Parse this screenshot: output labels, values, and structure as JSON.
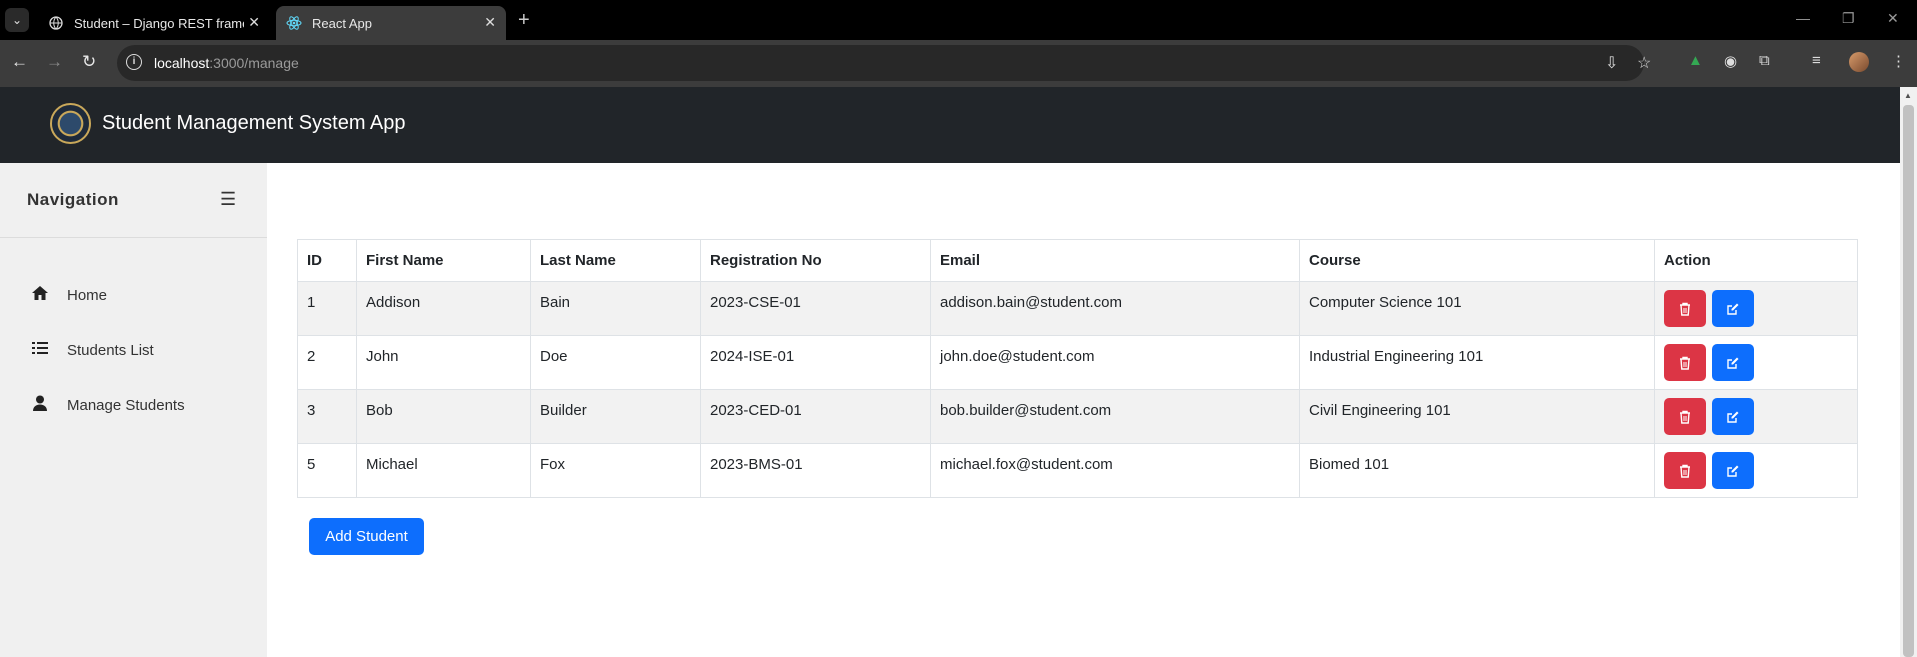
{
  "browser": {
    "tabs": [
      {
        "title": "Student – Django REST framew",
        "icon": "globe-icon",
        "active": false
      },
      {
        "title": "React App",
        "icon": "react-icon",
        "active": true
      }
    ],
    "url_host": "localhost",
    "url_path": ":3000/manage"
  },
  "app": {
    "title": "Student Management System App"
  },
  "sidebar": {
    "heading": "Navigation",
    "items": [
      {
        "label": "Home",
        "icon": "home-icon"
      },
      {
        "label": "Students List",
        "icon": "list-icon"
      },
      {
        "label": "Manage Students",
        "icon": "user-icon"
      }
    ]
  },
  "table": {
    "headers": [
      "ID",
      "First Name",
      "Last Name",
      "Registration No",
      "Email",
      "Course",
      "Action"
    ],
    "rows": [
      {
        "id": "1",
        "first": "Addison",
        "last": "Bain",
        "reg": "2023-CSE-01",
        "email": "addison.bain@student.com",
        "course": "Computer Science 101"
      },
      {
        "id": "2",
        "first": "John",
        "last": "Doe",
        "reg": "2024-ISE-01",
        "email": "john.doe@student.com",
        "course": "Industrial Engineering 101"
      },
      {
        "id": "3",
        "first": "Bob",
        "last": "Builder",
        "reg": "2023-CED-01",
        "email": "bob.builder@student.com",
        "course": "Civil Engineering 101"
      },
      {
        "id": "5",
        "first": "Michael",
        "last": "Fox",
        "reg": "2023-BMS-01",
        "email": "michael.fox@student.com",
        "course": "Biomed 101"
      }
    ]
  },
  "actions": {
    "add_student": "Add Student"
  },
  "colors": {
    "header_bg": "#212529",
    "sidebar_bg": "#f0f0f0",
    "delete": "#dc3545",
    "edit": "#0d6efd"
  }
}
